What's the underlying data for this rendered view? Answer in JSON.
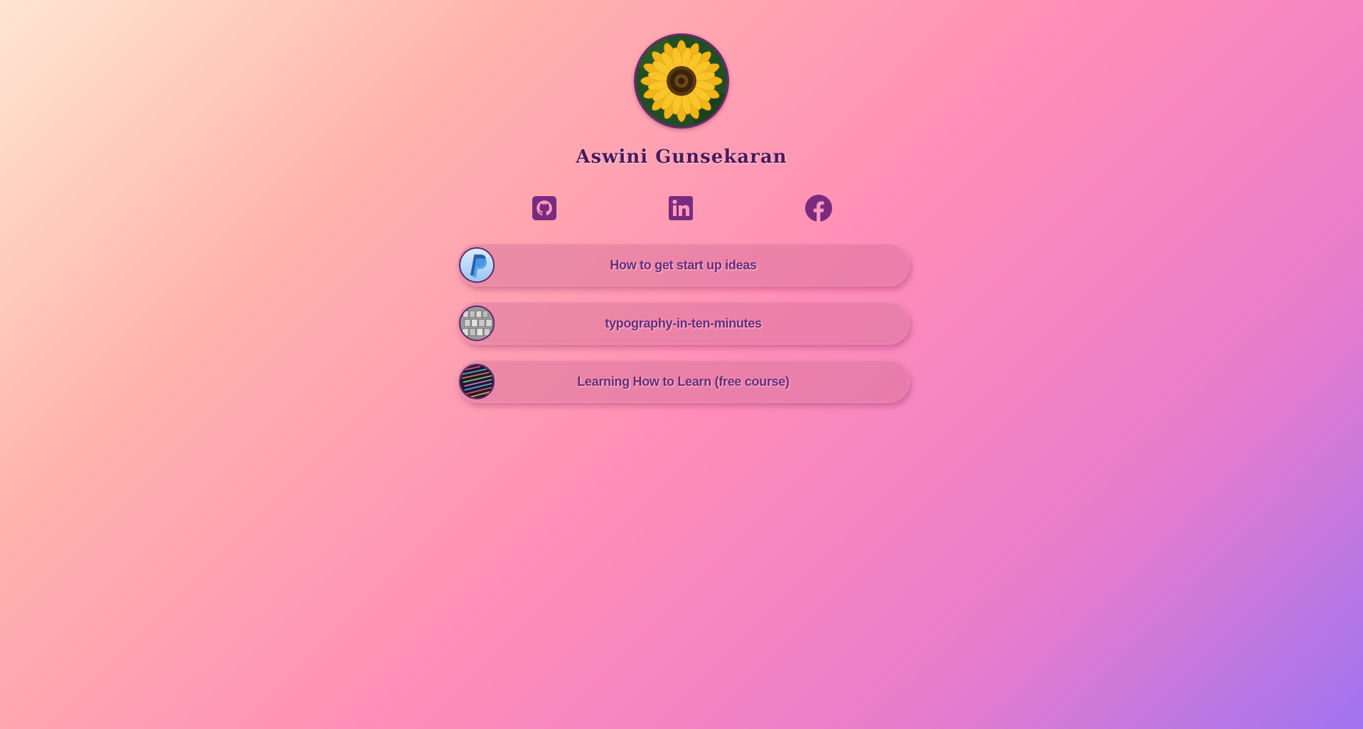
{
  "profile": {
    "name": "Aswini Gunsekaran",
    "avatar_icon": "sunflower-photo"
  },
  "social": [
    {
      "name": "github",
      "icon": "github-icon"
    },
    {
      "name": "linkedin",
      "icon": "linkedin-icon"
    },
    {
      "name": "facebook",
      "icon": "facebook-icon"
    }
  ],
  "links": [
    {
      "label": "How to get start up ideas",
      "thumb_icon": "paypal-logo"
    },
    {
      "label": "typography-in-ten-minutes",
      "thumb_icon": "type-blocks-photo"
    },
    {
      "label": "Learning How to Learn (free course)",
      "thumb_icon": "code-screen-photo"
    }
  ],
  "colors": {
    "accent": "#6b2a7a",
    "icon": "#7b2b7e"
  }
}
